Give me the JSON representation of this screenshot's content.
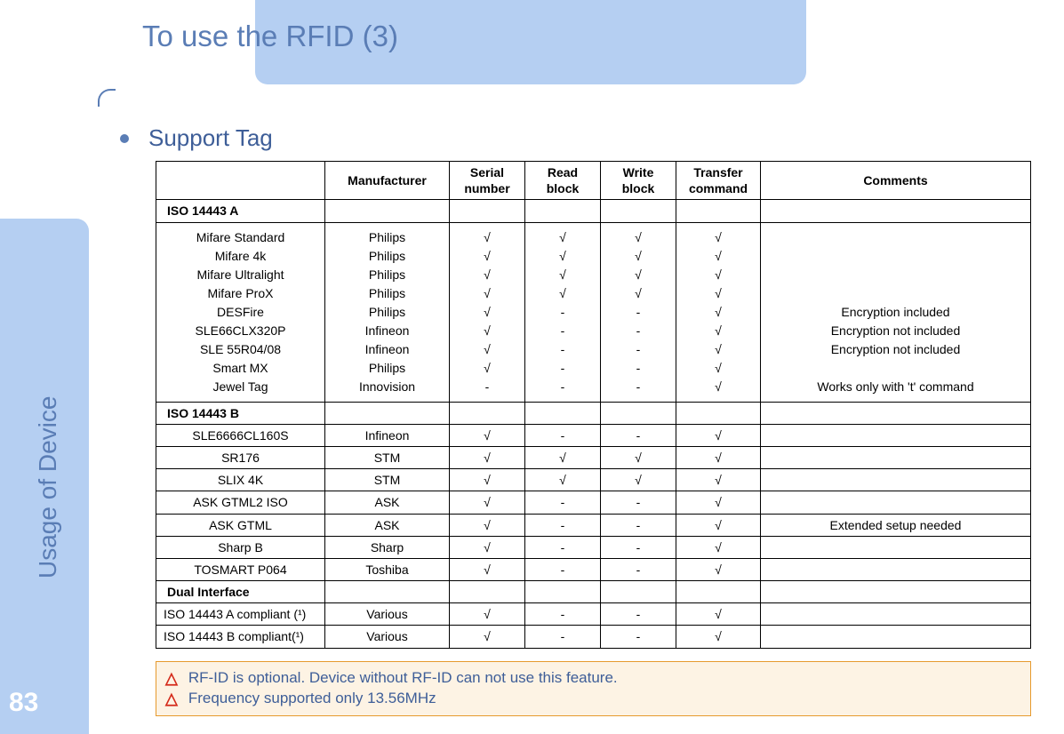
{
  "title": "To use the RFID (3)",
  "side_label": "Usage of Device",
  "page_number": "83",
  "section_title": "Support Tag",
  "headers": [
    "",
    "Manufacturer",
    "Serial number",
    "Read block",
    "Write block",
    "Transfer command",
    "Comments"
  ],
  "group_a_header": "ISO 14443 A",
  "group_a": {
    "names": "Mifare Standard\nMifare 4k\nMifare Ultralight\nMifare ProX\nDESFire\nSLE66CLX320P\nSLE 55R04/08\nSmart MX\nJewel Tag",
    "manufacturer": "Philips\nPhilips\nPhilips\nPhilips\nPhilips\nInfineon\nInfineon\nPhilips\nInnovision",
    "serial": "√\n√\n√\n√\n√\n√\n√\n√\n-",
    "read": "√\n√\n√\n√\n-\n-\n-\n-\n-",
    "write": "√\n√\n√\n√\n-\n-\n-\n-\n-",
    "transfer": "√\n√\n√\n√\n√\n√\n√\n√\n√",
    "comments": "\n\n\n\nEncryption included\nEncryption not included\nEncryption not included\n\nWorks only with 't' command"
  },
  "group_b_header": "ISO 14443 B",
  "group_b": [
    {
      "name": "SLE6666CL160S",
      "manufacturer": "Infineon",
      "serial": "√",
      "read": "-",
      "write": "-",
      "transfer": "√",
      "comments": ""
    },
    {
      "name": "SR176",
      "manufacturer": "STM",
      "serial": "√",
      "read": "√",
      "write": "√",
      "transfer": "√",
      "comments": ""
    },
    {
      "name": "SLIX 4K",
      "manufacturer": "STM",
      "serial": "√",
      "read": "√",
      "write": "√",
      "transfer": "√",
      "comments": ""
    },
    {
      "name": "ASK GTML2 ISO",
      "manufacturer": "ASK",
      "serial": "√",
      "read": "-",
      "write": "-",
      "transfer": "√",
      "comments": ""
    },
    {
      "name": "ASK GTML",
      "manufacturer": "ASK",
      "serial": "√",
      "read": "-",
      "write": "-",
      "transfer": "√",
      "comments": "Extended setup needed"
    },
    {
      "name": "Sharp B",
      "manufacturer": "Sharp",
      "serial": "√",
      "read": "-",
      "write": "-",
      "transfer": "√",
      "comments": ""
    },
    {
      "name": "TOSMART P064",
      "manufacturer": "Toshiba",
      "serial": "√",
      "read": "-",
      "write": "-",
      "transfer": "√",
      "comments": ""
    }
  ],
  "group_dual_header": "Dual Interface",
  "group_dual": [
    {
      "name": "ISO 14443 A compliant (¹)",
      "manufacturer": "Various",
      "serial": "√",
      "read": "-",
      "write": "-",
      "transfer": "√",
      "comments": ""
    },
    {
      "name": "ISO 14443 B compliant(¹)",
      "manufacturer": "Various",
      "serial": "√",
      "read": "-",
      "write": "-",
      "transfer": "√",
      "comments": ""
    }
  ],
  "warnings": [
    "RF-ID is optional. Device without RF-ID can not use this feature.",
    "Frequency supported only 13.56MHz"
  ]
}
